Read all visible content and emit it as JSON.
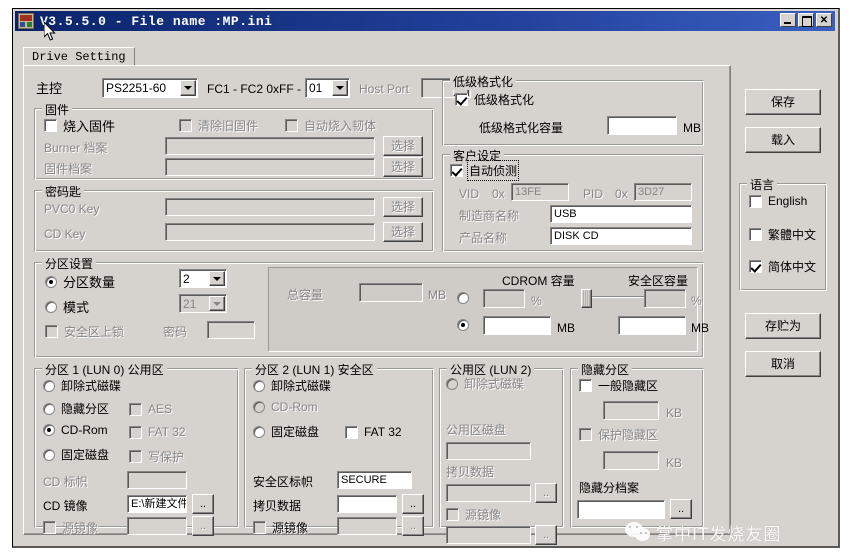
{
  "window": {
    "title": "V3.5.5.0 - File name :MP.ini",
    "icon": "app-icon",
    "buttons": {
      "minimize": "_",
      "maximize": "□",
      "close": "✕"
    }
  },
  "tab": {
    "label": "Drive Setting"
  },
  "top_row": {
    "controller_label": "主控",
    "controller_value": "PS2251-60",
    "fc_label": "FC1 - FC2   0xFF -",
    "fc_value": "01",
    "host_port_label": "Host Port",
    "host_port_value": ""
  },
  "firmware": {
    "title": "固件",
    "burn_fw_label": "烧入固件",
    "burn_fw_checked": false,
    "clear_old_label": "清除旧固件",
    "clear_old_checked": false,
    "auto_burn_label": "自动烧入韧体",
    "auto_burn_checked": false,
    "burner_file_label": "Burner 档案",
    "burner_file_value": "",
    "fw_file_label": "固件档案",
    "fw_file_value": "",
    "browse_label": "选择"
  },
  "password": {
    "title": "密码匙",
    "pvc0_label": "PVC0 Key",
    "pvc0_value": "",
    "cdkey_label": "CD Key",
    "cdkey_value": "",
    "browse_label": "选择"
  },
  "lowlevel": {
    "title": "低级格式化",
    "check_label": "低级格式化",
    "checked": true,
    "capacity_label": "低级格式化容量",
    "capacity_value": "",
    "unit": "MB"
  },
  "customer": {
    "title": "客户设定",
    "auto_detect_label": "自动侦测",
    "auto_detect_checked": true,
    "vid_label": "VID",
    "vid_prefix": "0x",
    "vid_value": "13FE",
    "pid_label": "PID",
    "pid_prefix": "0x",
    "pid_value": "3D27",
    "vendor_label": "制造商名称",
    "vendor_value": "USB",
    "product_label": "产品名称",
    "product_value": "DISK CD"
  },
  "partition_settings": {
    "title": "分区设置",
    "count_label": "分区数量",
    "count_selected": true,
    "count_value": "2",
    "mode_label": "模式",
    "mode_selected": false,
    "mode_value": "21",
    "lock_label": "安全区上锁",
    "lock_checked": false,
    "password_label": "密码",
    "password_value": "",
    "total_capacity_label": "总容量",
    "total_capacity_value": "",
    "total_unit": "MB",
    "cdrom_cap_label": "CDROM 容量",
    "secure_cap_label": "安全区容量",
    "percent_mode_selected": false,
    "mb_mode_selected": true,
    "cdrom_percent_value": "",
    "cdrom_mb_value": "",
    "secure_percent_value": "",
    "secure_mb_value": "",
    "percent_unit": "%",
    "mb_unit": "MB"
  },
  "part1": {
    "title": "分区 1 (LUN 0) 公用区",
    "removable_label": "卸除式磁碟",
    "removable_selected": false,
    "hidden_label": "隐藏分区",
    "hidden_selected": false,
    "cdrom_label": "CD-Rom",
    "cdrom_selected": true,
    "fixed_label": "固定磁盘",
    "fixed_selected": false,
    "aes_label": "AES",
    "aes_checked": false,
    "fat32_label": "FAT 32",
    "fat32_checked": false,
    "writeprotect_label": "写保护",
    "writeprotect_checked": false,
    "cd_label_label": "CD 标帜",
    "cd_label_value": "",
    "cd_image_label": "CD 镜像",
    "cd_image_value": "E:\\新建文件夹",
    "src_image_label": "源镜像",
    "src_image_checked": false,
    "src_image_value": "",
    "browse_label": ".."
  },
  "part2": {
    "title": "分区 2 (LUN 1) 安全区",
    "removable_label": "卸除式磁碟",
    "removable_selected": false,
    "cdrom_label": "CD-Rom",
    "cdrom_selected": false,
    "fixed_label": "固定磁盘",
    "fixed_selected": false,
    "fat32_label": "FAT 32",
    "fat32_checked": false,
    "secure_label_label": "安全区标帜",
    "secure_label_value": "SECURE",
    "copy_data_label": "拷贝数据",
    "copy_data_value": "",
    "src_image_label": "源镜像",
    "src_image_checked": false,
    "src_image_value": "",
    "browse_label": ".."
  },
  "part3": {
    "title": "公用区 (LUN 2)",
    "removable_label": "卸除式磁碟",
    "removable_selected": false,
    "disk_label": "公用区磁盘",
    "disk_value": "",
    "copy_data_label": "拷贝数据",
    "copy_data_value": "",
    "src_image_label": "源镜像",
    "src_image_checked": false,
    "src_image_value": "",
    "browse_label": ".."
  },
  "hidden_part": {
    "title": "隐藏分区",
    "normal_label": "一般隐藏区",
    "normal_checked": false,
    "normal_value": "",
    "normal_unit": "KB",
    "protect_label": "保护隐藏区",
    "protect_checked": false,
    "protect_value": "",
    "protect_unit": "KB",
    "file_label": "隐藏分档案",
    "file_value": "",
    "browse_label": ".."
  },
  "side": {
    "save_label": "保存",
    "load_label": "载入",
    "language_title": "语言",
    "lang_english_label": "English",
    "lang_english_checked": false,
    "lang_trad_label": "繁體中文",
    "lang_trad_checked": false,
    "lang_simp_label": "简体中文",
    "lang_simp_checked": true,
    "saveas_label": "存贮为",
    "cancel_label": "取消"
  },
  "watermark": {
    "text": "掌中IT发烧友圈",
    "logo": "wechat-logo"
  }
}
